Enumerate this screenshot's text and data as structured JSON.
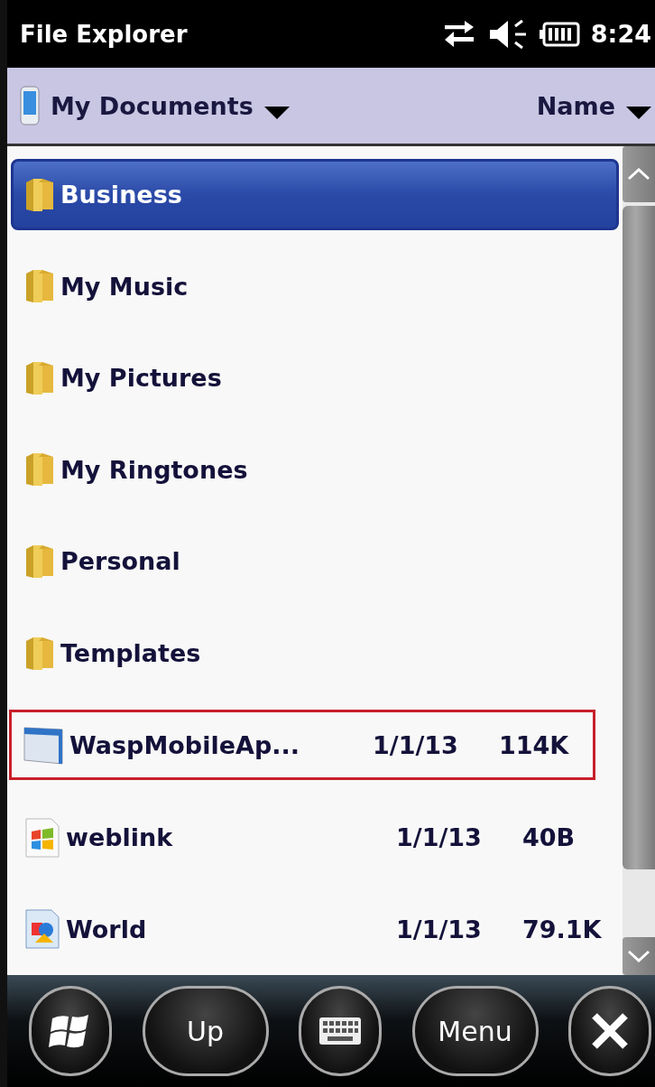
{
  "status_bar": {
    "title": "File Explorer",
    "time": "8:24"
  },
  "header": {
    "folder": "My Documents",
    "sort": "Name"
  },
  "files": [
    {
      "name": "Business",
      "kind": "folder",
      "selected": true,
      "highlighted": false
    },
    {
      "name": "My Music",
      "kind": "folder",
      "selected": false,
      "highlighted": false
    },
    {
      "name": "My Pictures",
      "kind": "folder",
      "selected": false,
      "highlighted": false
    },
    {
      "name": "My Ringtones",
      "kind": "folder",
      "selected": false,
      "highlighted": false
    },
    {
      "name": "Personal",
      "kind": "folder",
      "selected": false,
      "highlighted": false
    },
    {
      "name": "Templates",
      "kind": "folder",
      "selected": false,
      "highlighted": false
    },
    {
      "name": "WaspMobileAp...",
      "kind": "app",
      "date": "1/1/13",
      "size": "114K",
      "selected": false,
      "highlighted": true
    },
    {
      "name": "weblink",
      "kind": "link",
      "date": "1/1/13",
      "size": "40B",
      "selected": false,
      "highlighted": false
    },
    {
      "name": "World",
      "kind": "doc",
      "date": "1/1/13",
      "size": "79.1K",
      "selected": false,
      "highlighted": false
    }
  ],
  "softkeys": [
    {
      "kind": "start"
    },
    {
      "kind": "text",
      "label": "Up"
    },
    {
      "kind": "keyboard"
    },
    {
      "kind": "text",
      "label": "Menu"
    },
    {
      "kind": "close"
    }
  ]
}
